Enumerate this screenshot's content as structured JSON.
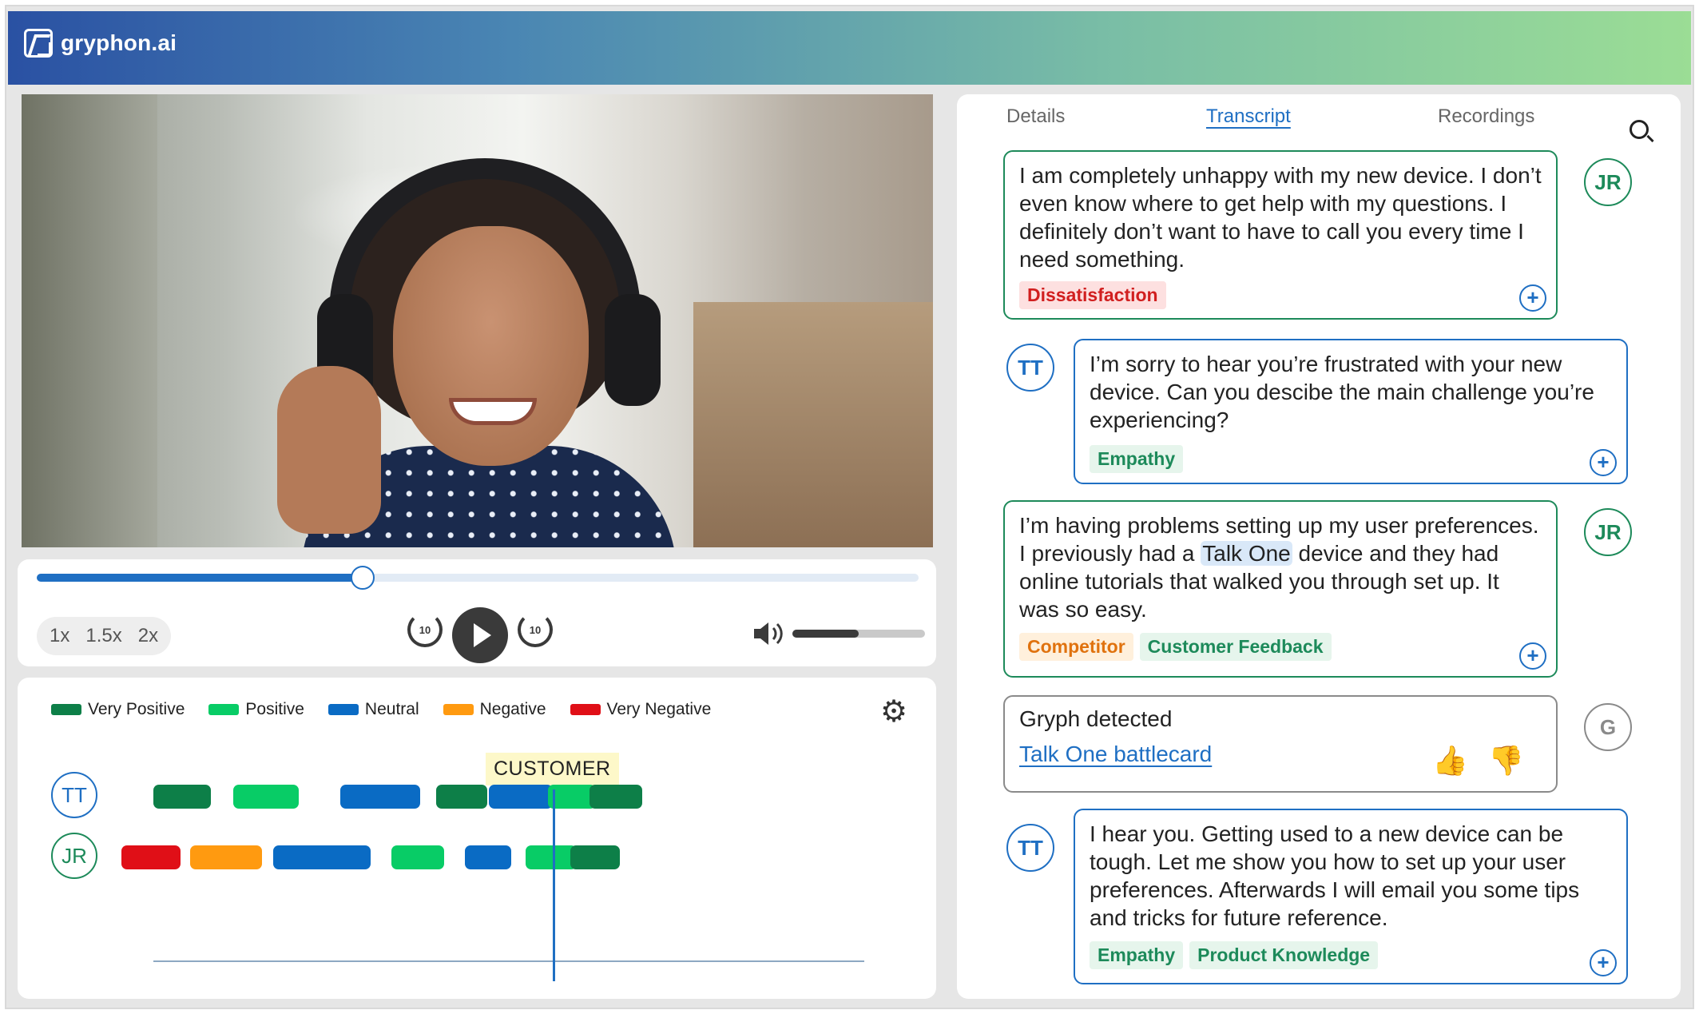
{
  "brand": {
    "name": "gryphon.ai"
  },
  "player": {
    "progress": 0.37,
    "speeds": [
      "1x",
      "1.5x",
      "2x"
    ],
    "skip_back_label": "10",
    "skip_forward_label": "10",
    "volume": 0.5
  },
  "sentiment": {
    "legend": [
      {
        "label": "Very Positive",
        "color": "#0d7f48"
      },
      {
        "label": "Positive",
        "color": "#08cc66"
      },
      {
        "label": "Neutral",
        "color": "#0a6bc4"
      },
      {
        "label": "Negative",
        "color": "#ff9a10"
      },
      {
        "label": "Very Negative",
        "color": "#e00f17"
      }
    ],
    "marker_label": "CUSTOMER",
    "lanes": [
      {
        "speaker": "TT",
        "segments": [
          {
            "sentiment": "Very Positive"
          },
          {
            "sentiment": "Positive"
          },
          {
            "sentiment": "Neutral"
          },
          {
            "sentiment": "Very Positive"
          },
          {
            "sentiment": "Neutral"
          },
          {
            "sentiment": "Positive"
          },
          {
            "sentiment": "Very Positive"
          }
        ]
      },
      {
        "speaker": "JR",
        "segments": [
          {
            "sentiment": "Very Negative"
          },
          {
            "sentiment": "Negative"
          },
          {
            "sentiment": "Neutral"
          },
          {
            "sentiment": "Positive"
          },
          {
            "sentiment": "Neutral"
          },
          {
            "sentiment": "Positive"
          },
          {
            "sentiment": "Very Positive"
          }
        ]
      }
    ]
  },
  "panel": {
    "tabs": [
      {
        "label": "Details"
      },
      {
        "label": "Transcript"
      },
      {
        "label": "Recordings"
      }
    ],
    "active_tab": "Transcript",
    "messages": [
      {
        "speaker": "JR",
        "text": "I am completely unhappy with my new device. I don’t even know where to get help with my questions. I definitely don’t want to have to call you every time I need something.",
        "tags": [
          "Dissatisfaction"
        ]
      },
      {
        "speaker": "TT",
        "text": "I’m sorry to hear you’re frustrated with your new device. Can you descibe the main challenge you’re experiencing?",
        "tags": [
          "Empathy"
        ]
      },
      {
        "speaker": "JR",
        "text_before": "I’m having problems setting up my user preferences. I previously had a ",
        "text_highlight": "Talk One",
        "text_after": " device and they had online tutorials that walked you through set up. It was so easy.",
        "tags": [
          "Competitor",
          "Customer Feedback"
        ]
      },
      {
        "speaker": "G",
        "title": "Gryph detected",
        "link": "Talk One battlecard"
      },
      {
        "speaker": "TT",
        "text": "I hear you. Getting used to a new device can be tough. Let me show you how to set up your user preferences. Afterwards I will email you some tips and tricks for future reference.",
        "tags": [
          "Empathy",
          "Product Knowledge"
        ]
      }
    ],
    "add_icon": "+"
  }
}
